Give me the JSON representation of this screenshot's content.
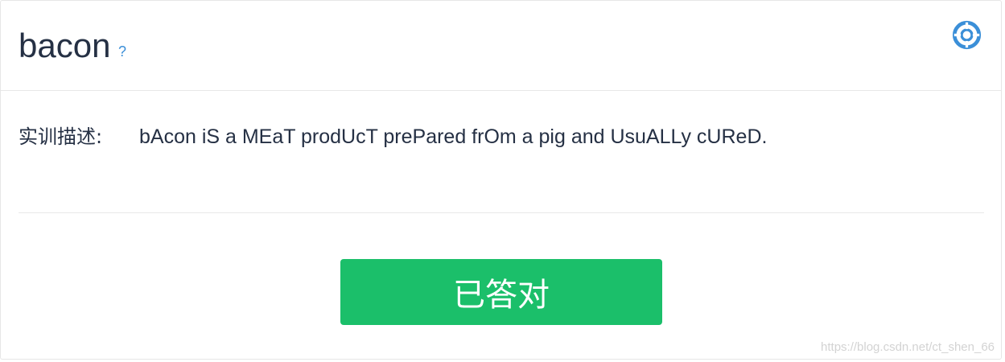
{
  "header": {
    "title": "bacon",
    "help_label": "?",
    "settings_icon": "lifebuoy-icon",
    "accent_color": "#3b8fd8"
  },
  "description": {
    "label": "实训描述:",
    "text": "bAcon iS a MEaT prodUcT prePared frOm a pig and UsuALLy cUReD."
  },
  "action": {
    "button_label": "已答对",
    "button_color": "#1bbf6a"
  },
  "watermark": "https://blog.csdn.net/ct_shen_66"
}
